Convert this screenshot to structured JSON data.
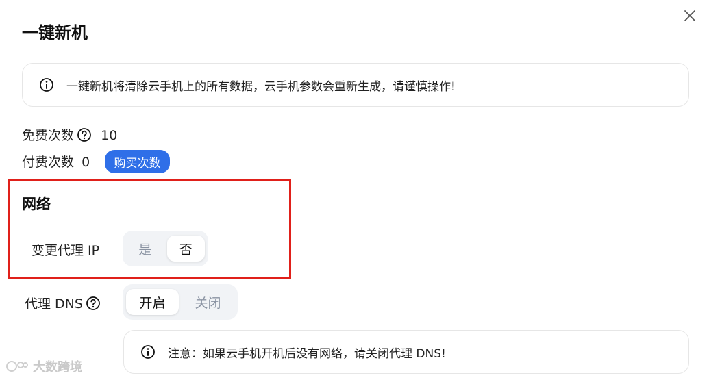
{
  "dialog": {
    "title": "一键新机",
    "warning": "一键新机将清除云手机上的所有数据，云手机参数会重新生成，请谨慎操作!"
  },
  "counts": {
    "free_label": "免费次数",
    "free_value": "10",
    "paid_label": "付费次数",
    "paid_value": "0",
    "buy_button": "购买次数"
  },
  "network": {
    "section_title": "网络",
    "proxy_ip_label": "变更代理 IP",
    "proxy_ip_options": [
      "是",
      "否"
    ],
    "proxy_ip_selected": "否",
    "proxy_dns_label": "代理 DNS",
    "proxy_dns_options": [
      "开启",
      "关闭"
    ],
    "proxy_dns_selected": "开启",
    "dns_notice": "注意：如果云手机开机后没有网络，请关闭代理 DNS!"
  },
  "watermark": "大数跨境",
  "colors": {
    "primary": "#2f6fe8",
    "highlight_border": "#e0201a"
  }
}
